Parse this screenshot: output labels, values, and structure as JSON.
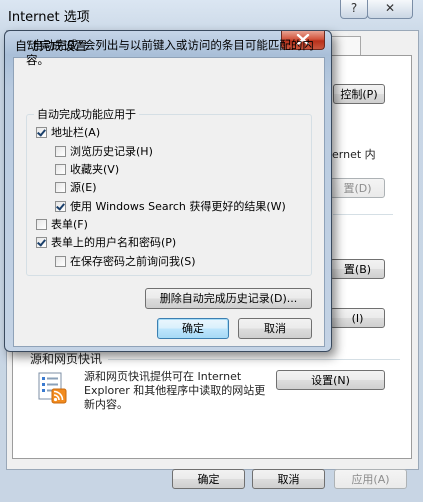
{
  "bg_window": {
    "title": "Internet 选项",
    "help_glyph": "?",
    "close_glyph": "✕",
    "tabs": [
      "",
      "",
      ""
    ],
    "buttons": {
      "content_control": "控制(P)",
      "feeds_settings": "设置(N)",
      "ok": "确定",
      "cancel": "取消",
      "apply": "应用(A)"
    },
    "partial_labels": {
      "internet_in": "ernet 内",
      "btn_d": "置(D)",
      "btn_b": "置(B)",
      "btn_i": "(I)"
    },
    "feeds_section_title": "源和网页快讯",
    "feeds_desc": "源和网页快讯提供可在 Internet Explorer 和其他程序中读取的网站更新内容。"
  },
  "dialog": {
    "title": "自动完成设置",
    "description": "“自动完成”会列出与以前键入或访问的条目可能匹配的内容。",
    "group_label": "自动完成功能应用于",
    "options": [
      {
        "label": "地址栏(A)",
        "checked": true
      },
      {
        "label": "浏览历史记录(H)",
        "checked": false
      },
      {
        "label": "收藏夹(V)",
        "checked": false
      },
      {
        "label": "源(E)",
        "checked": false
      },
      {
        "label": "使用 Windows Search 获得更好的结果(W)",
        "checked": true
      },
      {
        "label": "表单(F)",
        "checked": false
      },
      {
        "label": "表单上的用户名和密码(P)",
        "checked": true
      },
      {
        "label": "在保存密码之前询问我(S)",
        "checked": false
      }
    ],
    "delete_button": "删除自动完成历史记录(D)...",
    "ok_button": "确定",
    "cancel_button": "取消"
  },
  "colors": {
    "dialog_frame": "#a9bfd8",
    "close_button": "#c9563e",
    "default_button_border": "#3c7fb1"
  }
}
